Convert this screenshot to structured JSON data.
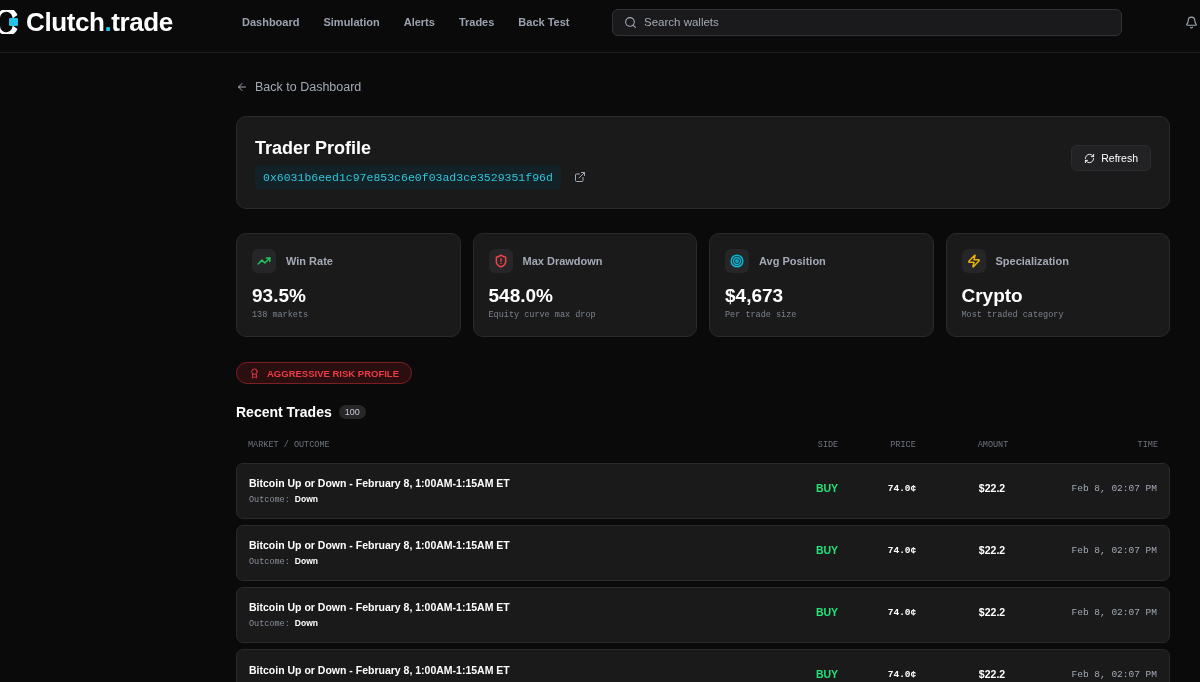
{
  "brand": {
    "parts": [
      {
        "text": "Clutch",
        "accent": false
      },
      {
        "text": ".",
        "accent": true
      },
      {
        "text": "trade",
        "accent": false
      }
    ]
  },
  "nav": [
    {
      "label": "Dashboard",
      "selected": false
    },
    {
      "label": "Simulation",
      "selected": false
    },
    {
      "label": "Alerts",
      "selected": false
    },
    {
      "label": "Trades",
      "selected": false
    },
    {
      "label": "Back Test",
      "selected": false
    }
  ],
  "search": {
    "placeholder": "Search wallets"
  },
  "back_link": "Back to Dashboard",
  "profile": {
    "title": "Trader Profile",
    "address": "0x6031b6eed1c97e853c6e0f03ad3ce3529351f96d",
    "refresh": "Refresh"
  },
  "stats": [
    {
      "label": "Win Rate",
      "value": "93.5%",
      "sub": "138 markets"
    },
    {
      "label": "Max Drawdown",
      "value": "548.0%",
      "sub": "Equity curve max drop"
    },
    {
      "label": "Avg Position",
      "value": "$4,673",
      "sub": "Per trade size"
    },
    {
      "label": "Specialization",
      "value": "Crypto",
      "sub": "Most traded category"
    }
  ],
  "risk_badge": "AGGRESSIVE RISK PROFILE",
  "recent_trades": {
    "title": "Recent Trades",
    "count": "100",
    "columns": [
      "MARKET / OUTCOME",
      "SIDE",
      "PRICE",
      "AMOUNT",
      "TIME"
    ],
    "rows": [
      {
        "market": "Bitcoin Up or Down - February 8, 1:00AM-1:15AM ET",
        "outcome_label": "Outcome:",
        "outcome": "Down",
        "side": {
          "label": "BUY",
          "color": "#22e27a"
        },
        "price": "74.0¢",
        "amount": "$22.2",
        "time": "Feb 8, 02:07 PM"
      },
      {
        "market": "Bitcoin Up or Down - February 8, 1:00AM-1:15AM ET",
        "outcome_label": "Outcome:",
        "outcome": "Down",
        "side": {
          "label": "BUY",
          "color": "#22e27a"
        },
        "price": "74.0¢",
        "amount": "$22.2",
        "time": "Feb 8, 02:07 PM"
      },
      {
        "market": "Bitcoin Up or Down - February 8, 1:00AM-1:15AM ET",
        "outcome_label": "Outcome:",
        "outcome": "Down",
        "side": {
          "label": "BUY",
          "color": "#22e27a"
        },
        "price": "74.0¢",
        "amount": "$22.2",
        "time": "Feb 8, 02:07 PM"
      },
      {
        "market": "Bitcoin Up or Down - February 8, 1:00AM-1:15AM ET",
        "side": {
          "label": "BUY",
          "color": "#22e27a"
        },
        "price": "74.0¢",
        "amount": "$22.2",
        "time": "Feb 8, 02:07 PM"
      }
    ]
  }
}
